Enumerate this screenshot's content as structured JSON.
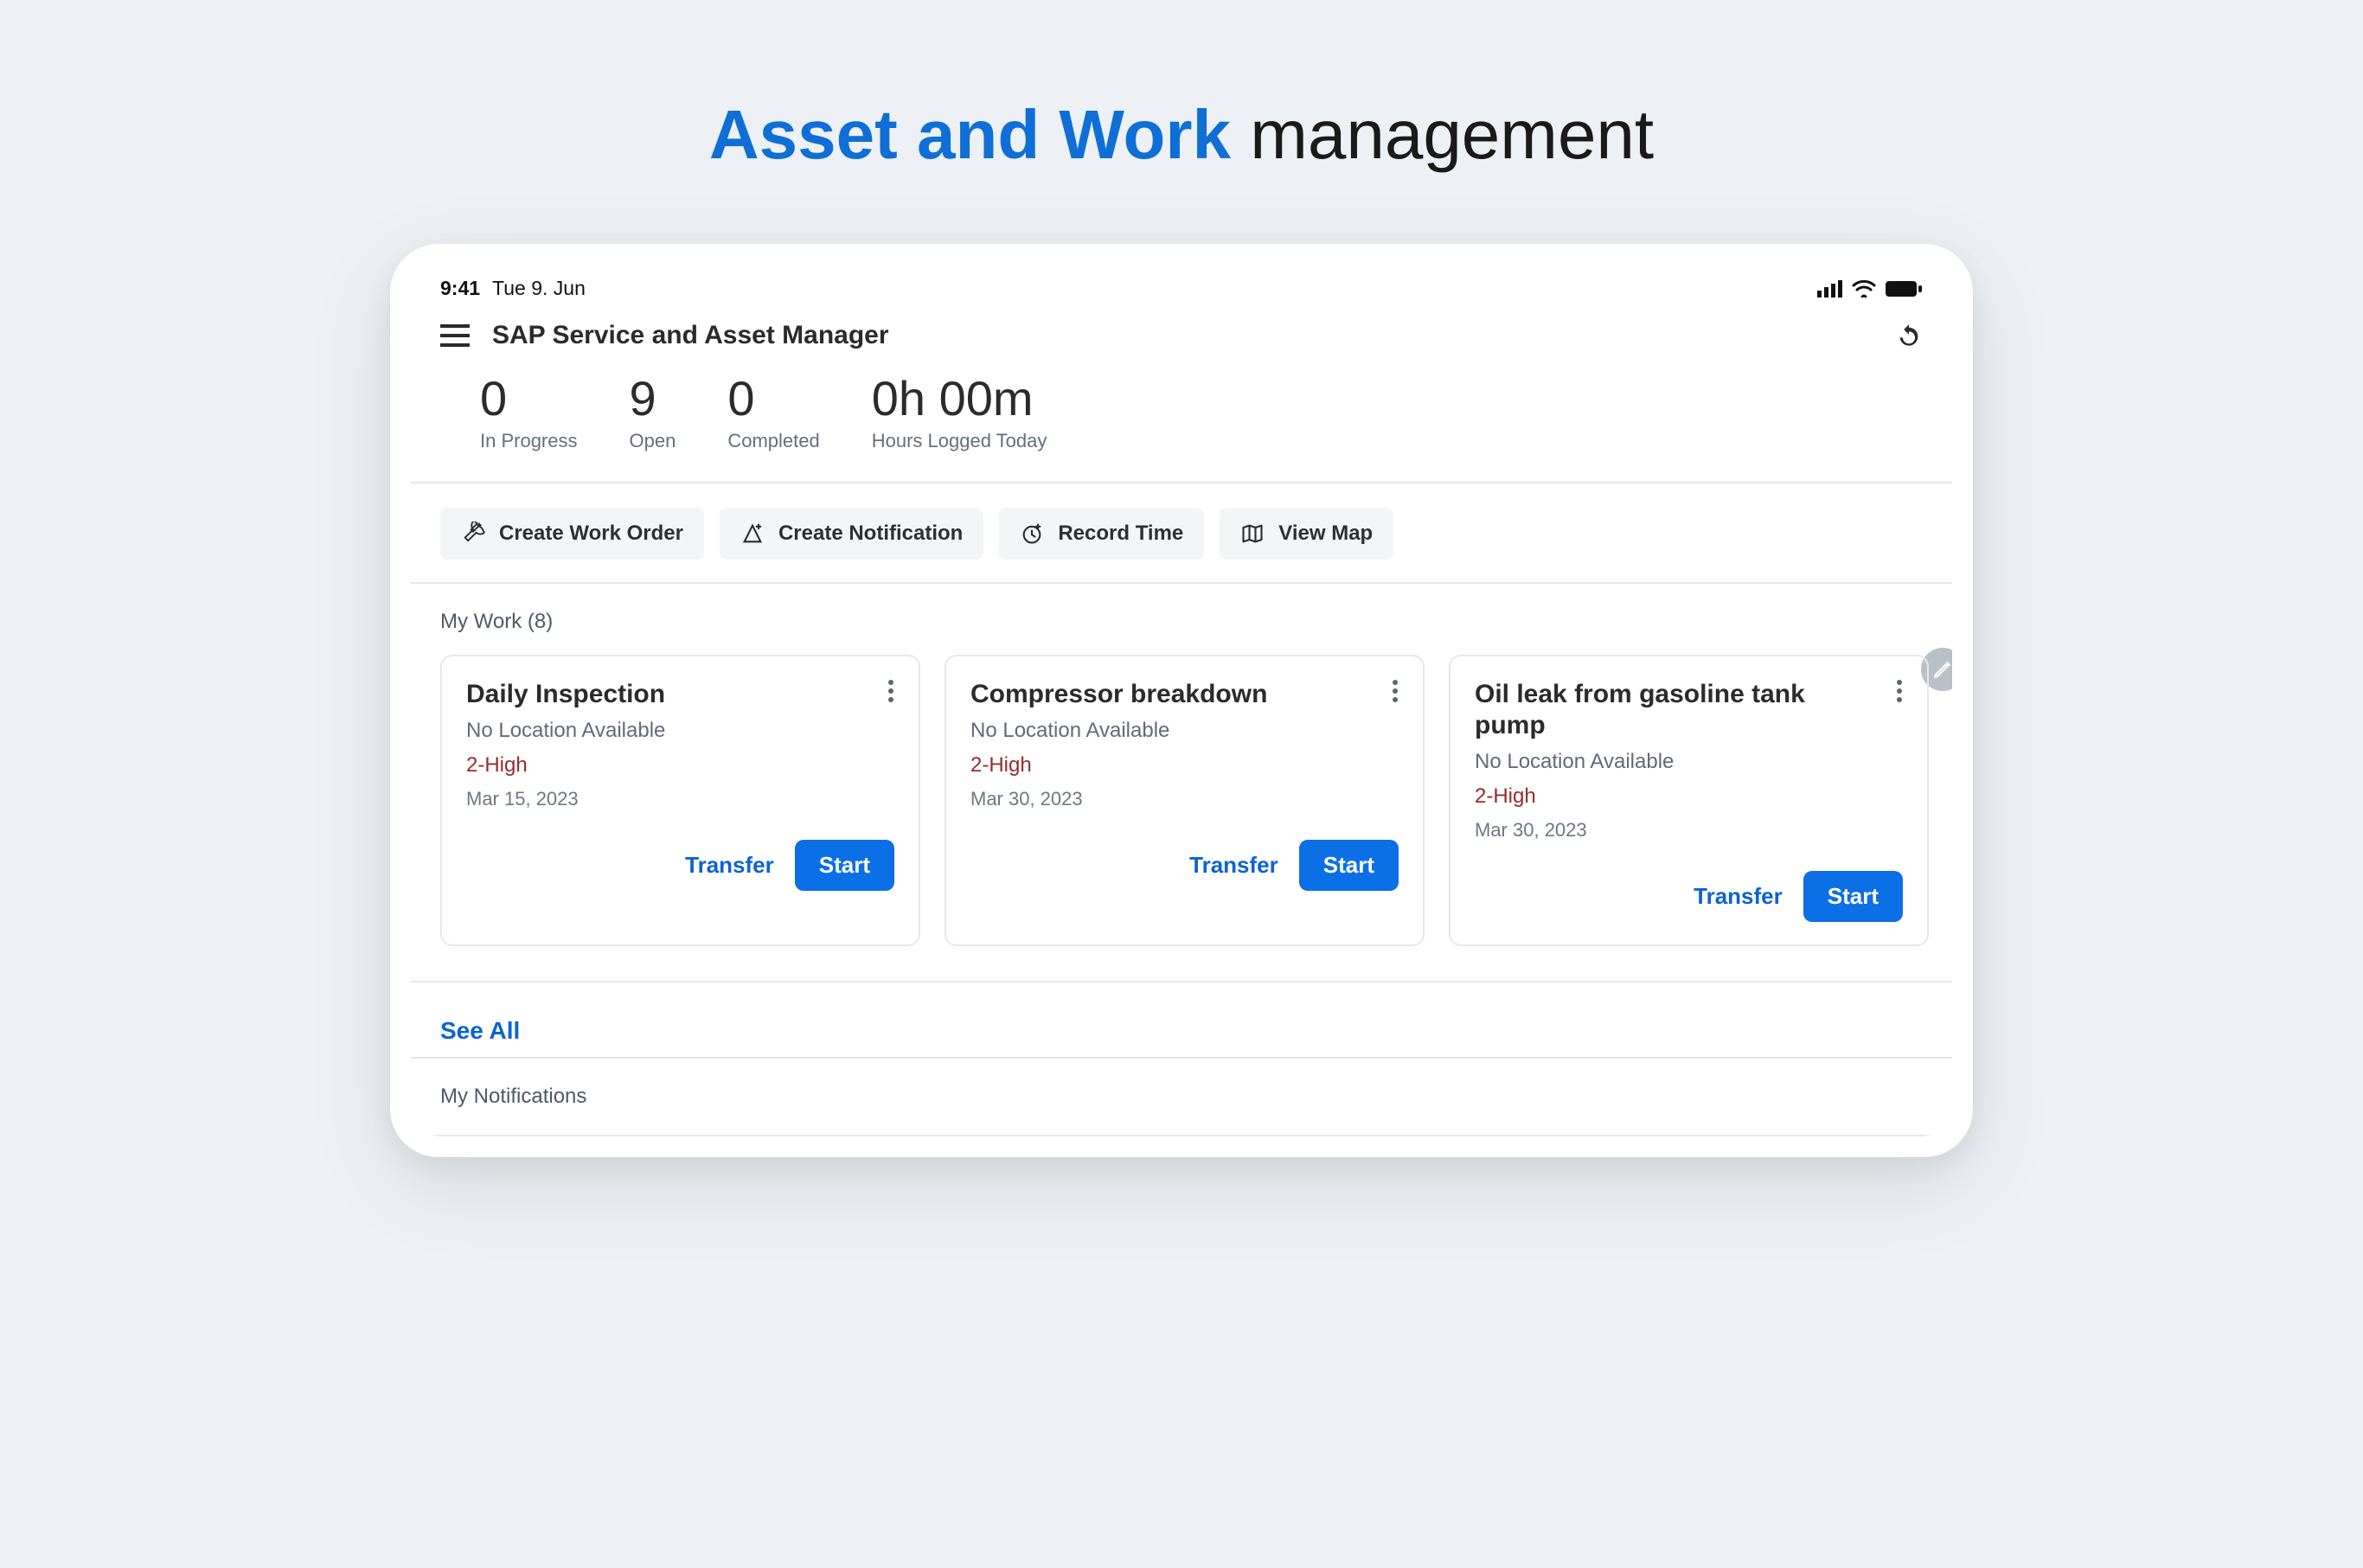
{
  "banner": {
    "bold": "Asset and Work",
    "rest": " management"
  },
  "status": {
    "time": "9:41",
    "date": "Tue 9. Jun"
  },
  "header": {
    "app_title": "SAP Service and Asset Manager"
  },
  "stats": {
    "in_progress": {
      "value": "0",
      "label": "In Progress"
    },
    "open": {
      "value": "9",
      "label": "Open"
    },
    "completed": {
      "value": "0",
      "label": "Completed"
    },
    "hours": {
      "value": "0h 00m",
      "label": "Hours Logged Today"
    }
  },
  "actions": {
    "create_work_order": "Create Work Order",
    "create_notification": "Create Notification",
    "record_time": "Record Time",
    "view_map": "View Map"
  },
  "mywork": {
    "label": "My Work (8)",
    "see_all": "See All",
    "transfer_label": "Transfer",
    "start_label": "Start",
    "items": [
      {
        "title": "Daily Inspection",
        "location": "No Location Available",
        "priority": "2-High",
        "date": "Mar 15, 2023"
      },
      {
        "title": "Compressor breakdown",
        "location": "No Location Available",
        "priority": "2-High",
        "date": "Mar 30, 2023"
      },
      {
        "title": "Oil leak from gasoline tank pump",
        "location": "No Location Available",
        "priority": "2-High",
        "date": "Mar 30, 2023"
      }
    ]
  },
  "notifications": {
    "label": "My Notifications"
  }
}
